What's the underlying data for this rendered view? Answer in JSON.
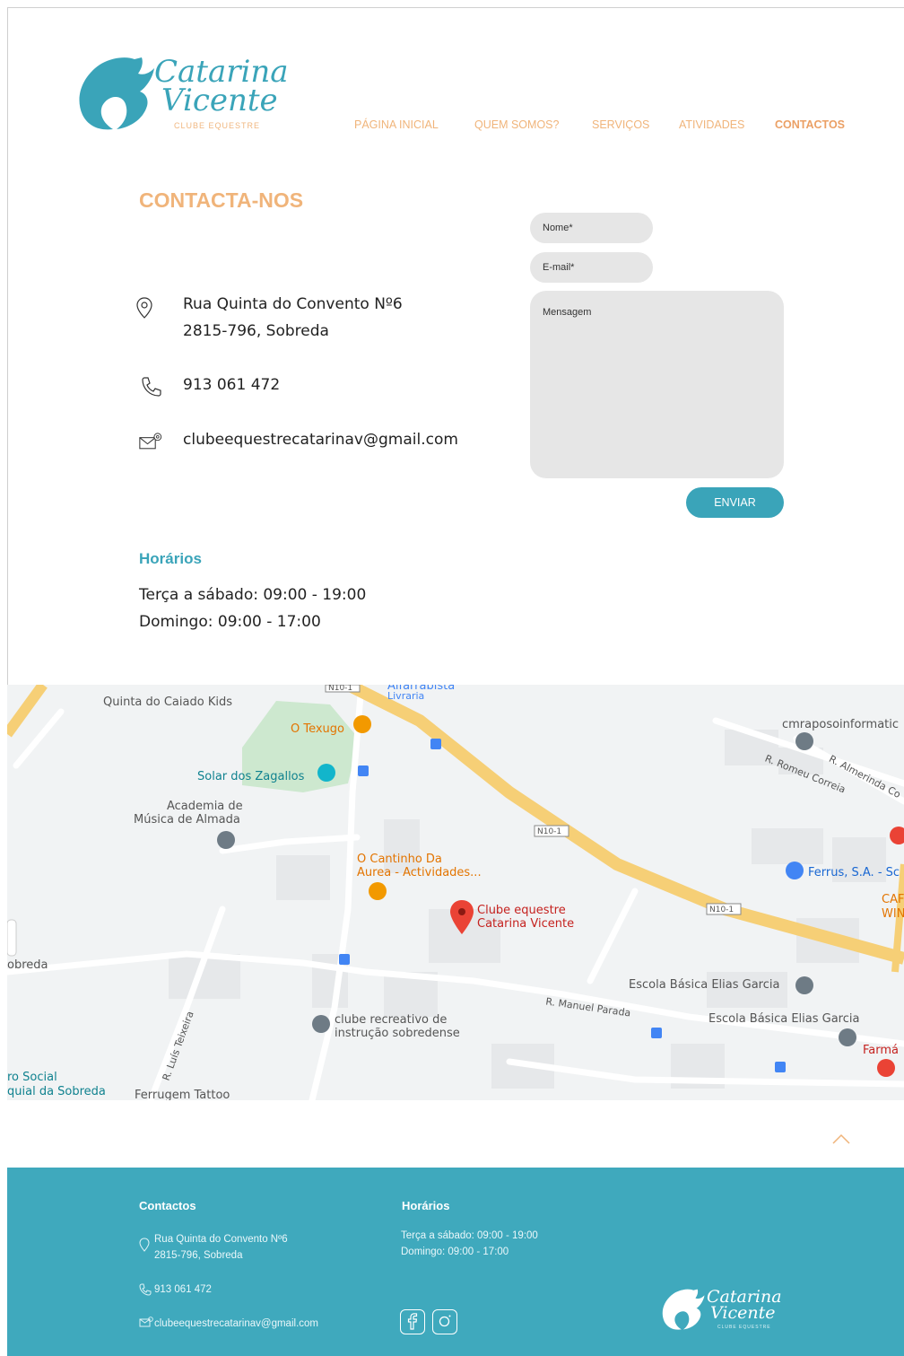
{
  "brand": {
    "name_line1": "Catarina",
    "name_line2": "Vicente",
    "subtitle": "CLUBE EQUESTRE"
  },
  "nav": {
    "items": [
      {
        "label": "PÁGINA INICIAL",
        "active": false
      },
      {
        "label": "QUEM SOMOS?",
        "active": false
      },
      {
        "label": "SERVIÇOS",
        "active": false
      },
      {
        "label": "ATIVIDADES",
        "active": false
      },
      {
        "label": "CONTACTOS",
        "active": true
      }
    ]
  },
  "contact": {
    "title": "CONTACTA-NOS",
    "address_line1": "Rua Quinta do Convento Nº6",
    "address_line2": "2815-796, Sobreda",
    "phone": "913 061 472",
    "email": "clubeequestrecatarinav@gmail.com"
  },
  "hours": {
    "title": "Horários",
    "weekdays": "Terça a sábado: 09:00 - 19:00",
    "sunday": "Domingo: 09:00 - 17:00"
  },
  "form": {
    "name_placeholder": "Nome*",
    "email_placeholder": "E-mail*",
    "message_placeholder": "Mensagem",
    "submit_label": "ENVIAR"
  },
  "map": {
    "labels": {
      "quinta_caiado": "Quinta do Caiado Kids",
      "alfarrabista": "Alfarrabista",
      "livraria": "Livraria",
      "texugo": "O Texugo",
      "cmraposo": "cmraposoinformatic",
      "romeu": "R. Romeu Correia",
      "almerinda": "R. Almerinda Co",
      "solar": "Solar dos Zagallos",
      "academia1": "Academia de",
      "academia2": "Música de Almada",
      "n10_a": "N10-1",
      "n10_b": "N10-1",
      "n10_c": "N10-1",
      "cantinho1": "O Cantinho Da",
      "cantinho2": "Aurea - Actividades...",
      "clube1": "Clube equestre",
      "clube2": "Catarina Vicente",
      "ferrus": "Ferrus, S.A. - Sc",
      "car1": "CAF",
      "car2": "WIN",
      "sobreda": "obreda",
      "escola1": "Escola Básica Elias Garcia",
      "escola2": "Escola Básica Elias Garcia",
      "manuel": "R. Manuel Parada",
      "luis": "R. Luís Teixeira",
      "recreativo1": "clube recreativo de",
      "recreativo2": "instrução sobredense",
      "farma": "Farmá",
      "social1": "ro Social",
      "social2": "quial da Sobreda",
      "ferrugem": "Ferrugem Tattoo"
    }
  },
  "footer": {
    "contacts_title": "Contactos",
    "address_line1": "Rua Quinta do Convento Nº6",
    "address_line2": "2815-796, Sobreda",
    "phone": "913 061 472",
    "email": "clubeequestrecatarinav@gmail.com",
    "hours_title": "Horários",
    "hours_weekdays": "Terça a sábado: 09:00 - 19:00",
    "hours_sunday": "Domingo: 09:00 - 17:00",
    "logo_line1": "Catarina",
    "logo_line2": "Vicente",
    "logo_sub": "CLUBE EQUESTRE"
  },
  "colors": {
    "accent_teal": "#3aa4b9",
    "accent_orange": "#f0b47a",
    "footer_bg": "#3fa9bd",
    "field_bg": "#e6e6e6"
  },
  "icons": [
    "location-pin-icon",
    "phone-icon",
    "email-icon",
    "chevron-up-icon",
    "facebook-icon",
    "instagram-icon"
  ]
}
